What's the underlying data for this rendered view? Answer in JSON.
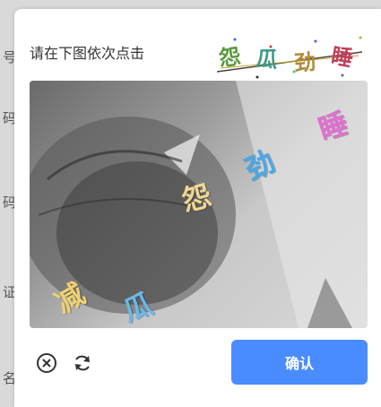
{
  "background_labels": [
    "号",
    "码",
    "码",
    "证",
    "名"
  ],
  "dialog": {
    "prompt": "请在下图依次点击",
    "target_chars": [
      {
        "char": "怨",
        "color": "#5a9a3a"
      },
      {
        "char": "瓜",
        "color": "#3a9a8a"
      },
      {
        "char": "劲",
        "color": "#b08a3a"
      },
      {
        "char": "睡",
        "color": "#c0405a"
      }
    ],
    "image_chars": [
      {
        "char": "睡",
        "color": "#e070d0"
      },
      {
        "char": "劲",
        "color": "#4aa8e8"
      },
      {
        "char": "怨",
        "color": "#f0d890"
      },
      {
        "char": "减",
        "color": "#f0d070"
      },
      {
        "char": "瓜",
        "color": "#6ab8e8"
      }
    ],
    "confirm_label": "确认",
    "close_icon": "close-circle-icon",
    "refresh_icon": "refresh-icon"
  }
}
